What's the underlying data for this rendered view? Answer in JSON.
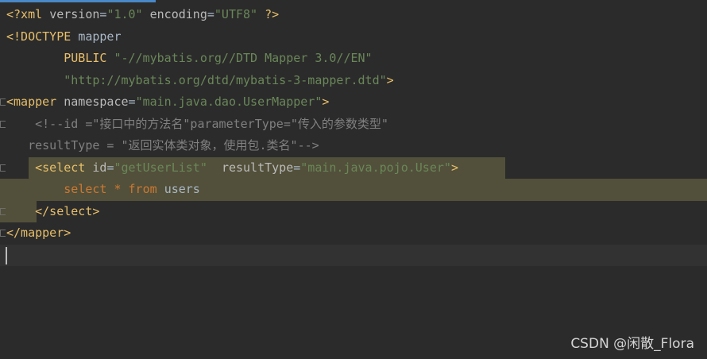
{
  "editor": {
    "lines": {
      "l1": {
        "a": "<?xml ",
        "b": "version",
        "c": "=",
        "d": "\"1.0\"",
        "e": " ",
        "f": "encoding",
        "g": "=",
        "h": "\"UTF8\"",
        "i": " ?>"
      },
      "l2": {
        "a": "<!DOCTYPE ",
        "b": "mapper"
      },
      "l3": {
        "indent": "        ",
        "a": "PUBLIC ",
        "b": "\"-//mybatis.org//DTD Mapper 3.0//EN\""
      },
      "l4": {
        "indent": "        ",
        "a": "\"http://mybatis.org/dtd/mybatis-3-mapper.dtd\"",
        "b": ">"
      },
      "l5": {
        "a": "<mapper ",
        "b": "namespace",
        "c": "=",
        "d": "\"main.java.dao.UserMapper\"",
        "e": ">"
      },
      "l6": {
        "text": "    <!--id =\"接口中的方法名\"parameterType=\"传入的参数类型\""
      },
      "l7": {
        "text": "   resultType = \"返回实体类对象，使用包.类名\"-->"
      },
      "l8": {
        "indent": "    ",
        "a": "<select ",
        "b": "id",
        "c": "=",
        "d": "\"getUserList\"",
        "e": "  ",
        "f": "resultType",
        "g": "=",
        "h": "\"main.java.pojo.User\"",
        "i": ">"
      },
      "l9": {
        "indent": "        ",
        "a": "select ",
        "b": "* ",
        "c": "from ",
        "d": "users"
      },
      "l10": {
        "indent": "    ",
        "a": "</select>"
      },
      "l11": {
        "a": "</mapper>"
      }
    }
  },
  "colors": {
    "background": "#2b2b2b",
    "tag": "#e8bf6a",
    "string": "#6a8759",
    "keyword": "#cc7832",
    "comment": "#808080",
    "highlight": "#52503a"
  },
  "watermark": {
    "text": "CSDN @闲散_Flora"
  }
}
